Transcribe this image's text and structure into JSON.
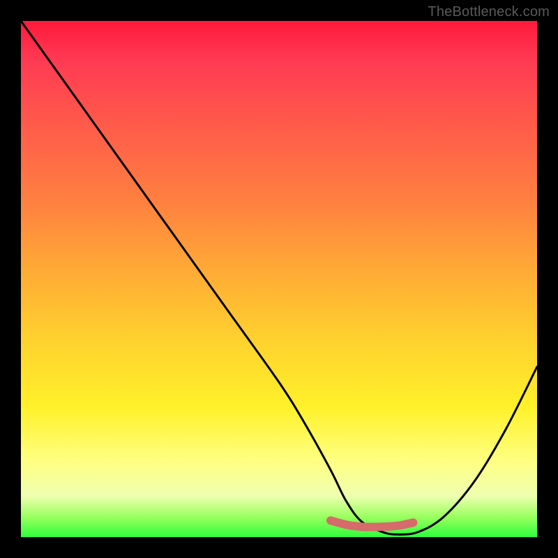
{
  "watermark": "TheBottleneck.com",
  "chart_data": {
    "type": "line",
    "title": "",
    "xlabel": "",
    "ylabel": "",
    "xlim": [
      0,
      100
    ],
    "ylim": [
      0,
      100
    ],
    "series": [
      {
        "name": "bottleneck-curve",
        "x": [
          0,
          10,
          20,
          30,
          40,
          50,
          55,
          60,
          63,
          66,
          70,
          73,
          77,
          82,
          88,
          94,
          100
        ],
        "y": [
          100,
          86,
          72,
          58,
          44,
          30,
          22,
          13,
          7,
          3,
          1,
          0.5,
          1,
          4,
          11,
          21,
          33
        ]
      }
    ],
    "highlight_segment": {
      "name": "flat-bottom",
      "x": [
        60,
        63,
        66,
        70,
        73,
        76
      ],
      "y": [
        3.2,
        2.4,
        2.0,
        2.0,
        2.2,
        2.8
      ],
      "color": "#d76a6a",
      "width": 12
    },
    "gradient_stops": [
      {
        "pos": 0.0,
        "color": "#ff1a3c"
      },
      {
        "pos": 0.08,
        "color": "#ff3b53"
      },
      {
        "pos": 0.2,
        "color": "#ff5a4a"
      },
      {
        "pos": 0.35,
        "color": "#ff8040"
      },
      {
        "pos": 0.48,
        "color": "#ffa936"
      },
      {
        "pos": 0.62,
        "color": "#ffd22e"
      },
      {
        "pos": 0.75,
        "color": "#fff12a"
      },
      {
        "pos": 0.85,
        "color": "#ffff80"
      },
      {
        "pos": 0.92,
        "color": "#efffb0"
      },
      {
        "pos": 0.96,
        "color": "#9cff60"
      },
      {
        "pos": 1.0,
        "color": "#2eff3c"
      }
    ]
  }
}
